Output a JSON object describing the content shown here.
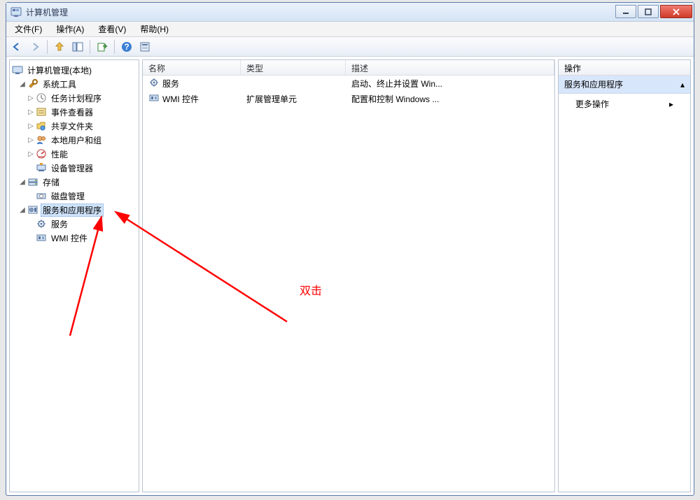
{
  "window": {
    "title": "计算机管理"
  },
  "menu": {
    "file": "文件(F)",
    "action": "操作(A)",
    "view": "查看(V)",
    "help": "帮助(H)"
  },
  "tree": {
    "root": "计算机管理(本地)",
    "system_tools": "系统工具",
    "task_scheduler": "任务计划程序",
    "event_viewer": "事件查看器",
    "shared_folders": "共享文件夹",
    "local_users": "本地用户和组",
    "performance": "性能",
    "device_manager": "设备管理器",
    "storage": "存储",
    "disk_mgmt": "磁盘管理",
    "services_apps": "服务和应用程序",
    "services": "服务",
    "wmi": "WMI 控件"
  },
  "list": {
    "headers": {
      "name": "名称",
      "type": "类型",
      "desc": "描述"
    },
    "rows": [
      {
        "name": "服务",
        "type": "",
        "desc": "启动、终止并设置 Win..."
      },
      {
        "name": "WMI 控件",
        "type": "扩展管理单元",
        "desc": "配置和控制 Windows ..."
      }
    ]
  },
  "actions": {
    "header": "操作",
    "section": "服务和应用程序",
    "more": "更多操作"
  },
  "annotation": {
    "label": "双击"
  }
}
